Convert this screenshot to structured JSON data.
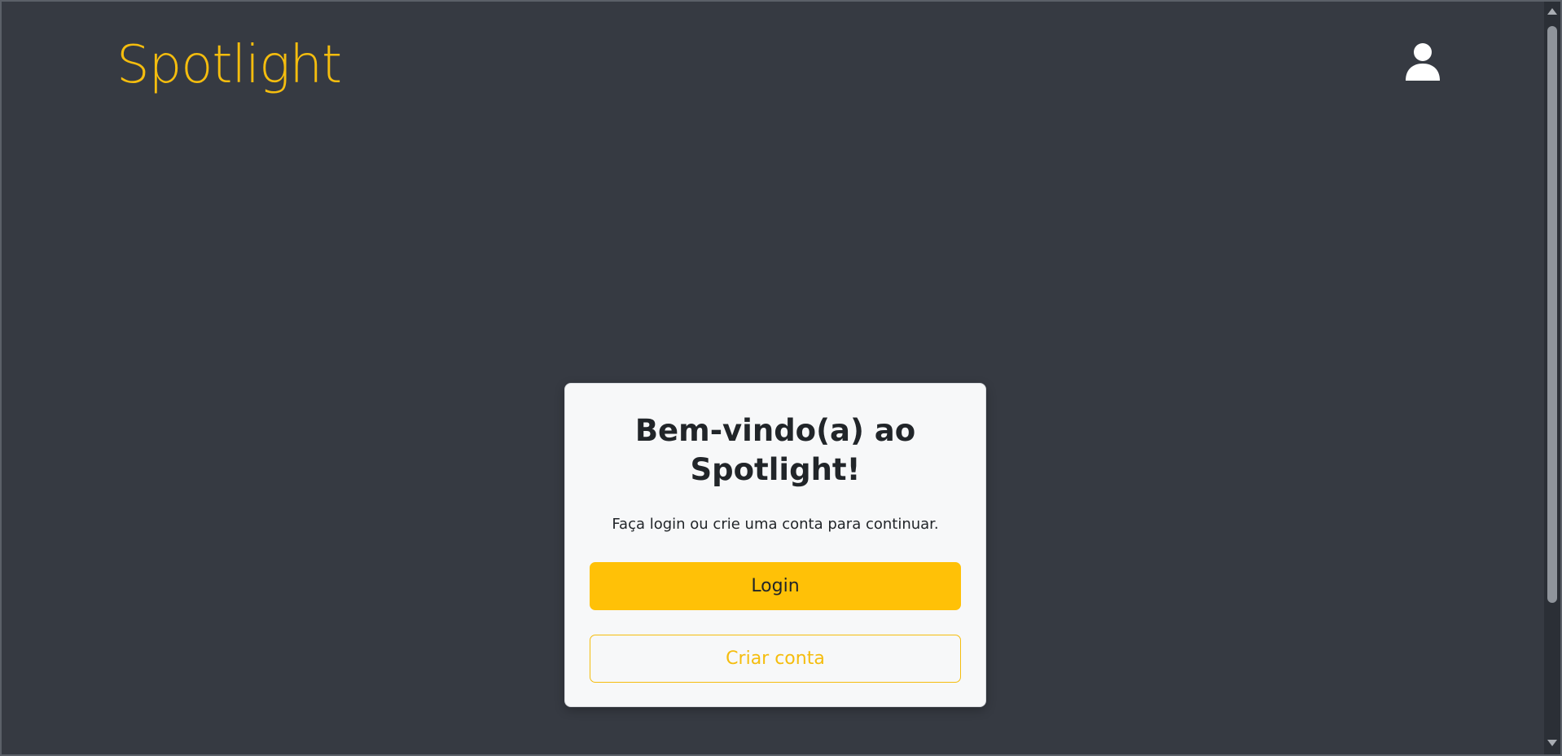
{
  "header": {
    "brand": "Spotlight",
    "user_icon": "user-icon"
  },
  "welcome_card": {
    "title": "Bem-vindo(a) ao Spotlight!",
    "text": "Faça login ou crie uma conta para continuar.",
    "login_label": "Login",
    "create_account_label": "Criar conta"
  },
  "colors": {
    "background": "#363a42",
    "accent": "#ffc107",
    "brand_text": "#f5bd0e",
    "card_background": "#f7f8f9",
    "text_dark": "#212529"
  }
}
